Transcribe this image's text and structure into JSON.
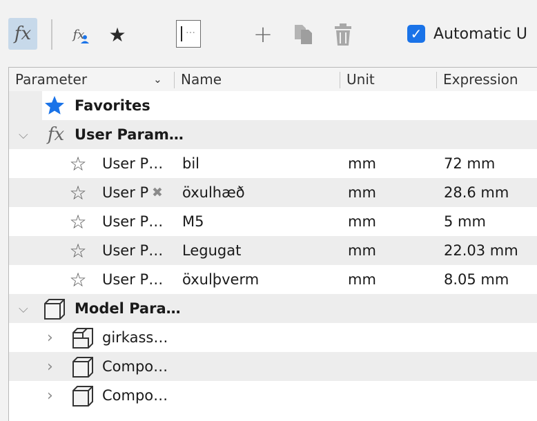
{
  "toolbar": {
    "fx_label": "fx",
    "fxuser_label": "fx",
    "filter_placeholder": "…",
    "auto_checked": true,
    "auto_label": "Automatic U"
  },
  "columns": {
    "parameter": "Parameter",
    "name": "Name",
    "unit": "Unit",
    "expression": "Expression"
  },
  "groups": {
    "favorites": "Favorites",
    "user_params": "User Param…",
    "model_params": "Model Para…"
  },
  "user_rows": [
    {
      "parameter": "User P…",
      "name": "bil",
      "unit": "mm",
      "expression": "72 mm"
    },
    {
      "parameter": "User P",
      "name": "öxulhæð",
      "unit": "mm",
      "expression": "28.6 mm"
    },
    {
      "parameter": "User P…",
      "name": "M5",
      "unit": "mm",
      "expression": "5 mm"
    },
    {
      "parameter": "User P…",
      "name": "Legugat",
      "unit": "mm",
      "expression": "22.03 mm"
    },
    {
      "parameter": "User P…",
      "name": "öxulþverm",
      "unit": "mm",
      "expression": "8.05 mm"
    }
  ],
  "model_rows": [
    {
      "label": "girkass…",
      "icon": "assembly-icon"
    },
    {
      "label": "Compo…",
      "icon": "component-icon"
    },
    {
      "label": "Compo…",
      "icon": "component-icon"
    }
  ],
  "colors": {
    "accent": "#1a73e8",
    "favorite_star": "#1a73e8",
    "selected_bg": "#c7d9ea"
  }
}
